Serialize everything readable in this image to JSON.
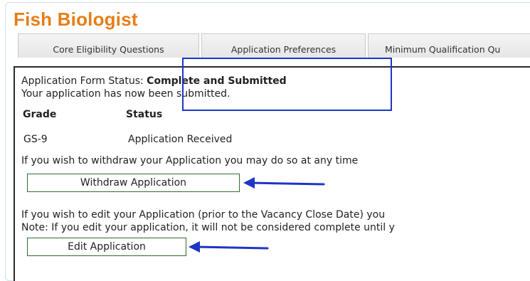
{
  "page": {
    "title": "Fish Biologist"
  },
  "tabs": [
    {
      "label": "Core Eligibility Questions"
    },
    {
      "label": "Application Preferences"
    },
    {
      "label": "Minimum Qualification Qu"
    }
  ],
  "status": {
    "label": "Application Form Status:",
    "value": "Complete and Submitted",
    "message": "Your application has now been submitted."
  },
  "grade_table": {
    "headers": [
      "Grade",
      "Status"
    ],
    "rows": [
      {
        "grade": "GS-9",
        "status": "Application Received"
      }
    ]
  },
  "withdraw": {
    "text": "If you wish to withdraw your Application you may do so at any time",
    "button_label": "Withdraw Application"
  },
  "edit": {
    "text": "If you wish to edit your Application (prior to the Vacancy Close Date) you",
    "note": "Note: If you edit your application, it will not be considered complete until y",
    "button_label": "Edit Application"
  },
  "colors": {
    "title": "#e67e16",
    "annotation": "#1e35c8",
    "button_border": "#2f6b2f"
  }
}
